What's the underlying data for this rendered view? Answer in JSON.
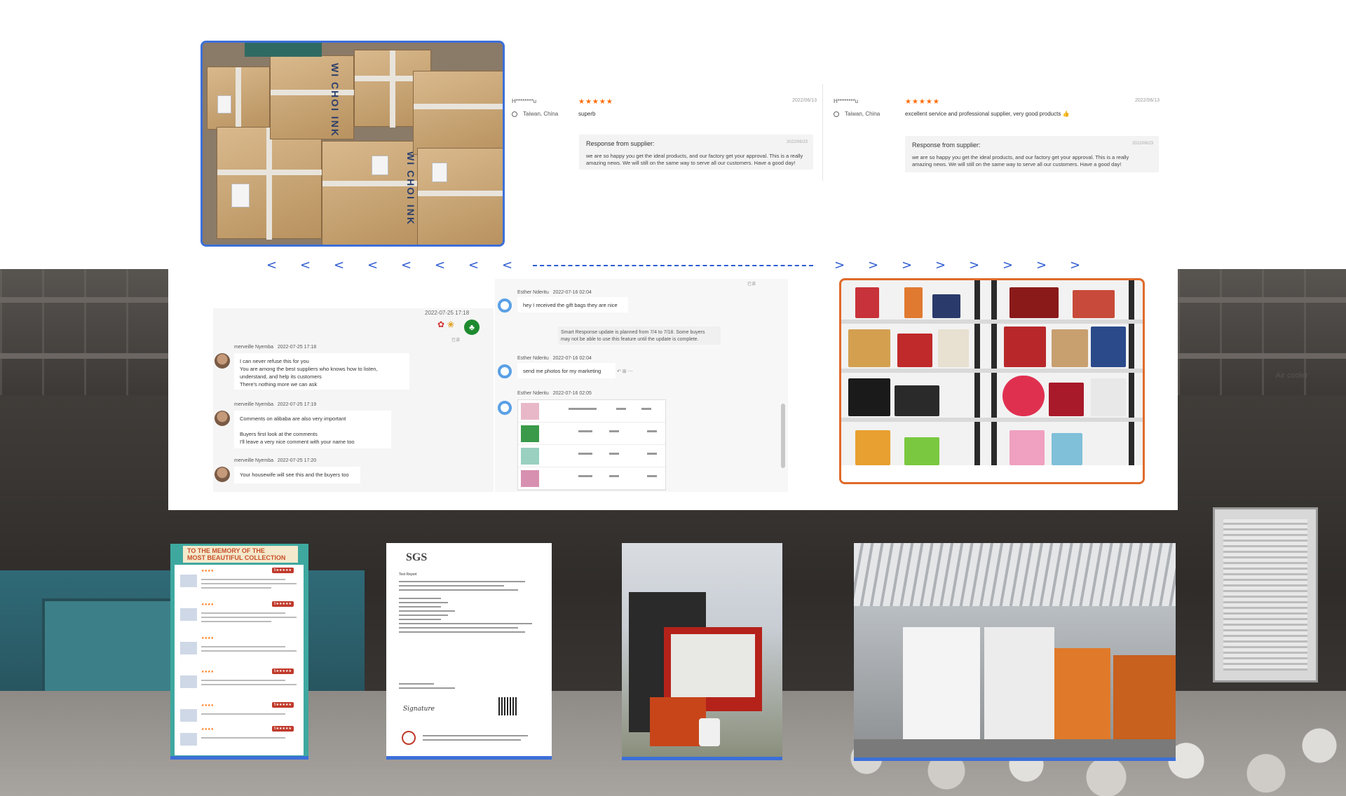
{
  "reviews": [
    {
      "reviewer": "H********u",
      "location": "Taiwan, China",
      "stars": "★★★★★",
      "comment": "superb",
      "date": "2022/06/13",
      "response_title": "Response from supplier:",
      "response_date": "2022/06/23",
      "response_text_1": "we are so happy you get the ideal products, and our factory get your approval. This is a really",
      "response_text_2": "amazing news. We will still on the same way to serve all our customers. Have a good day!"
    },
    {
      "reviewer": "H********u",
      "location": "Taiwan, China",
      "stars": "★★★★★",
      "comment": "excellent service and professional supplier, very good products 👍",
      "date": "2022/06/13",
      "response_title": "Response from supplier:",
      "response_date": "2022/06/23",
      "response_text_1": "we are so happy you get the ideal products, and our factory get your approval. This is a really",
      "response_text_2": "amazing news. We will still on the same way to serve all our customers. Have a good day!"
    }
  ],
  "arrows": {
    "left": "<",
    "right": ">"
  },
  "chat_left": {
    "top_date": "2022-07-25 17:18",
    "read_mark": "已读",
    "messages": [
      {
        "name": "merveille Nyemba",
        "time": "2022-07-25 17:18",
        "lines": [
          "I can never refuse this for you",
          "You are among the best suppliers who knows how to listen,",
          "understand, and help its customers",
          "There's nothing more we can ask"
        ]
      },
      {
        "name": "merveille Nyemba",
        "time": "2022-07-25 17:19",
        "lines": [
          "Comments on alibaba are also very important",
          "",
          "Buyers first look at the comments",
          "I'll leave a very nice comment with your name too"
        ]
      },
      {
        "name": "merveille Nyemba",
        "time": "2022-07-25 17:20",
        "lines": [
          "Your housewife will see this and the buyers too"
        ]
      }
    ]
  },
  "chat_right": {
    "read_mark": "已读",
    "messages": [
      {
        "name": "Esther Nderitu",
        "time": "2022-07-16 02:04",
        "text": "hey I received the gift bags they are nice"
      },
      {
        "name": "Esther Nderitu",
        "time": "2022-07-16 02:04",
        "text": "send me photos for my marketing"
      },
      {
        "name": "Esther Nderitu",
        "time": "2022-07-16 02:05",
        "text": ""
      }
    ],
    "system_note_1": "Smart Response update is planned from 7/4 to 7/18. Some buyers",
    "system_note_2": "may not be able to use this feature until the update is complete."
  },
  "cards": {
    "collection_title_1": "TO THE MEMORY OF THE",
    "collection_title_2": "MOST BEAUTIFUL COLLECTION",
    "collection_rating": "5★★★★★",
    "sgs_logo": "SGS",
    "sgs_title": "Test Report",
    "aircooler_label": "Air cooler"
  },
  "photo_prints": {
    "box_print_1": "WI CHOI INK",
    "box_print_2": "WI CHOI INK"
  },
  "colors": {
    "accent_blue": "#3c6fd8",
    "accent_orange": "#e06a2a",
    "star_orange": "#ff6a00"
  }
}
